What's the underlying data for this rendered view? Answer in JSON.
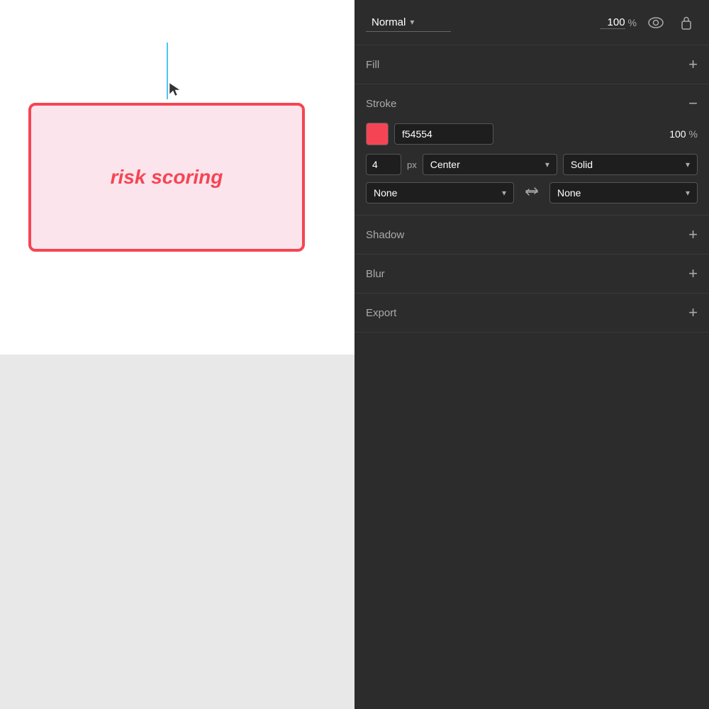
{
  "canvas": {
    "label": "canvas-area"
  },
  "risk_box": {
    "text": "risk scoring",
    "border_color": "#f54554",
    "bg_color": "#fce4ec",
    "text_color": "#f54554"
  },
  "panel": {
    "blend_mode": {
      "label": "Normal",
      "chevron": "▾"
    },
    "opacity": {
      "value": "100",
      "unit": "%"
    },
    "eye_icon": "👁",
    "lock_icon": "🔒",
    "fill_section": {
      "title": "Fill",
      "add_icon": "+"
    },
    "stroke_section": {
      "title": "Stroke",
      "minus_icon": "−",
      "color_hex": "f54554",
      "opacity_value": "100",
      "opacity_unit": "%",
      "width_value": "4",
      "width_unit": "px",
      "align_label": "Center",
      "align_chevron": "▾",
      "style_label": "Solid",
      "style_chevron": "▾",
      "start_label": "None",
      "start_chevron": "▾",
      "swap_icon": "⇆",
      "end_label": "None",
      "end_chevron": "▾"
    },
    "shadow_section": {
      "title": "Shadow",
      "add_icon": "+"
    },
    "blur_section": {
      "title": "Blur",
      "add_icon": "+"
    },
    "export_section": {
      "title": "Export",
      "add_icon": "+"
    }
  }
}
